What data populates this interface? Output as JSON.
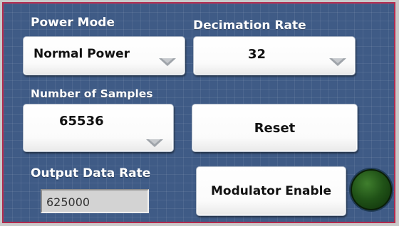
{
  "power_mode": {
    "label": "Power Mode",
    "value": "Normal Power",
    "icon": "dropdown-arrow-icon"
  },
  "decimation_rate": {
    "label": "Decimation Rate",
    "value": "32",
    "icon": "dropdown-arrow-icon"
  },
  "number_of_samples": {
    "label": "Number of Samples",
    "value": "65536",
    "icon": "dropdown-arrow-icon"
  },
  "reset_button": {
    "label": "Reset"
  },
  "output_data_rate": {
    "label": "Output Data Rate",
    "value": "625000"
  },
  "modulator_enable": {
    "label": "Modulator Enable",
    "indicator_state": "off",
    "indicator_color": "#205217"
  },
  "colors": {
    "panel_background": "#3f5b86",
    "panel_border": "#b22a4e",
    "label_text": "#ffffff"
  }
}
